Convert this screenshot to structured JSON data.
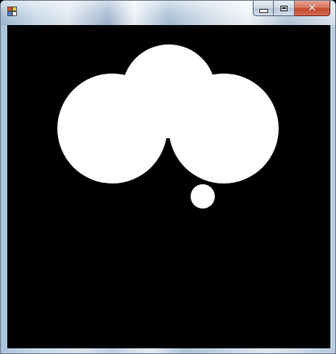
{
  "window": {
    "title": "",
    "icon": "windows-app-icon",
    "controls": {
      "minimize_icon": "minimize-icon",
      "maximize_icon": "maximize-icon",
      "close_icon": "close-icon",
      "close_glyph": "✕"
    }
  },
  "canvas": {
    "background_color": "#000000",
    "shape_color": "#ffffff",
    "shapes": [
      "circle-left",
      "circle-top",
      "circle-right",
      "circle-small"
    ]
  },
  "colors": {
    "close_button": "#c44a2f",
    "frame": "#b9cde0"
  }
}
